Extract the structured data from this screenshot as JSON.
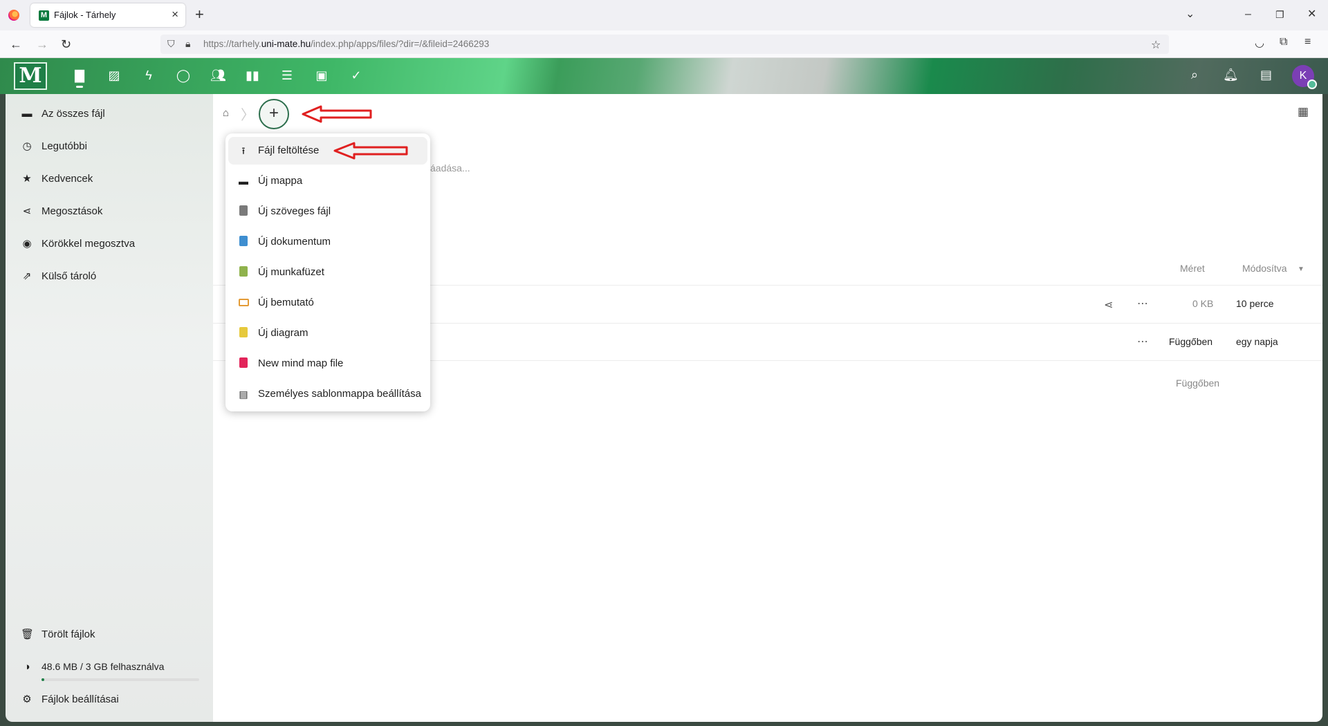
{
  "browser": {
    "tab_title": "Fájlok - Tárhely",
    "tab_favicon": "M",
    "url_prefix": "https://tarhely.",
    "url_domain": "uni-mate.hu",
    "url_suffix": "/index.php/apps/files/?dir=/&fileid=2466293"
  },
  "header": {
    "logo_letter": "M",
    "avatar_letter": "K",
    "apps": [
      "files-icon",
      "photos-icon",
      "activity-icon",
      "talk-icon",
      "contacts-icon",
      "analytics-icon",
      "deck-icon",
      "user-icon",
      "tasks-icon"
    ]
  },
  "sidebar": {
    "items": [
      {
        "label": "Az összes fájl",
        "icon": "folder-icon"
      },
      {
        "label": "Legutóbbi",
        "icon": "clock-icon"
      },
      {
        "label": "Kedvencek",
        "icon": "star-icon"
      },
      {
        "label": "Megosztások",
        "icon": "share-icon"
      },
      {
        "label": "Körökkel megosztva",
        "icon": "circles-icon"
      },
      {
        "label": "Külső tároló",
        "icon": "external-link-icon"
      }
    ],
    "deleted_files": "Törölt fájlok",
    "quota": "48.6 MB / 3 GB felhasználva",
    "quota_fraction": 0.016,
    "settings": "Fájlok beállításai"
  },
  "new_menu": {
    "items": [
      {
        "label": "Fájl feltöltése",
        "icon": "upload-icon",
        "color": "#222222"
      },
      {
        "label": "Új mappa",
        "icon": "folder-icon",
        "color": "#222222"
      },
      {
        "label": "Új szöveges fájl",
        "icon": "text-file-icon",
        "color": "#7a7a7a"
      },
      {
        "label": "Új dokumentum",
        "icon": "document-icon",
        "color": "#3e8ed0"
      },
      {
        "label": "Új munkafüzet",
        "icon": "spreadsheet-icon",
        "color": "#8fb24c"
      },
      {
        "label": "Új bemutató",
        "icon": "presentation-icon",
        "color": "#e39b36"
      },
      {
        "label": "Új diagram",
        "icon": "diagram-icon",
        "color": "#e6c93c"
      },
      {
        "label": "New mind map file",
        "icon": "mindmap-icon",
        "color": "#e2245a"
      },
      {
        "label": "Személyes sablonmappa beállítása",
        "icon": "template-icon",
        "color": "#222222"
      }
    ]
  },
  "files": {
    "partial_text": "áadása...",
    "columns": {
      "size": "Méret",
      "modified": "Módosítva"
    },
    "rows": [
      {
        "size": "0 KB",
        "modified": "10 perce"
      },
      {
        "size": "Függőben",
        "modified": "egy napja"
      }
    ],
    "summary_size": "Függőben"
  },
  "colors": {
    "accent": "#1f7f47",
    "annotation_arrow": "#e02020"
  }
}
